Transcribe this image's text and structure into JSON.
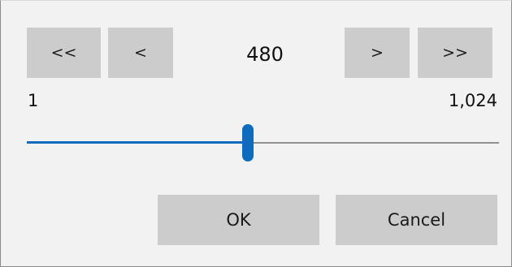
{
  "navigation": {
    "first_label": "<<",
    "prev_label": "<",
    "next_label": ">",
    "last_label": ">>"
  },
  "value": "480",
  "range": {
    "min_label": "1",
    "max_label": "1,024",
    "min": 1,
    "max": 1024,
    "current": 480
  },
  "slider": {
    "fill_color": "#0f6cbd",
    "track_color": "#8f8f8f",
    "thumb_color": "#0f6cbd"
  },
  "actions": {
    "ok_label": "OK",
    "cancel_label": "Cancel"
  }
}
